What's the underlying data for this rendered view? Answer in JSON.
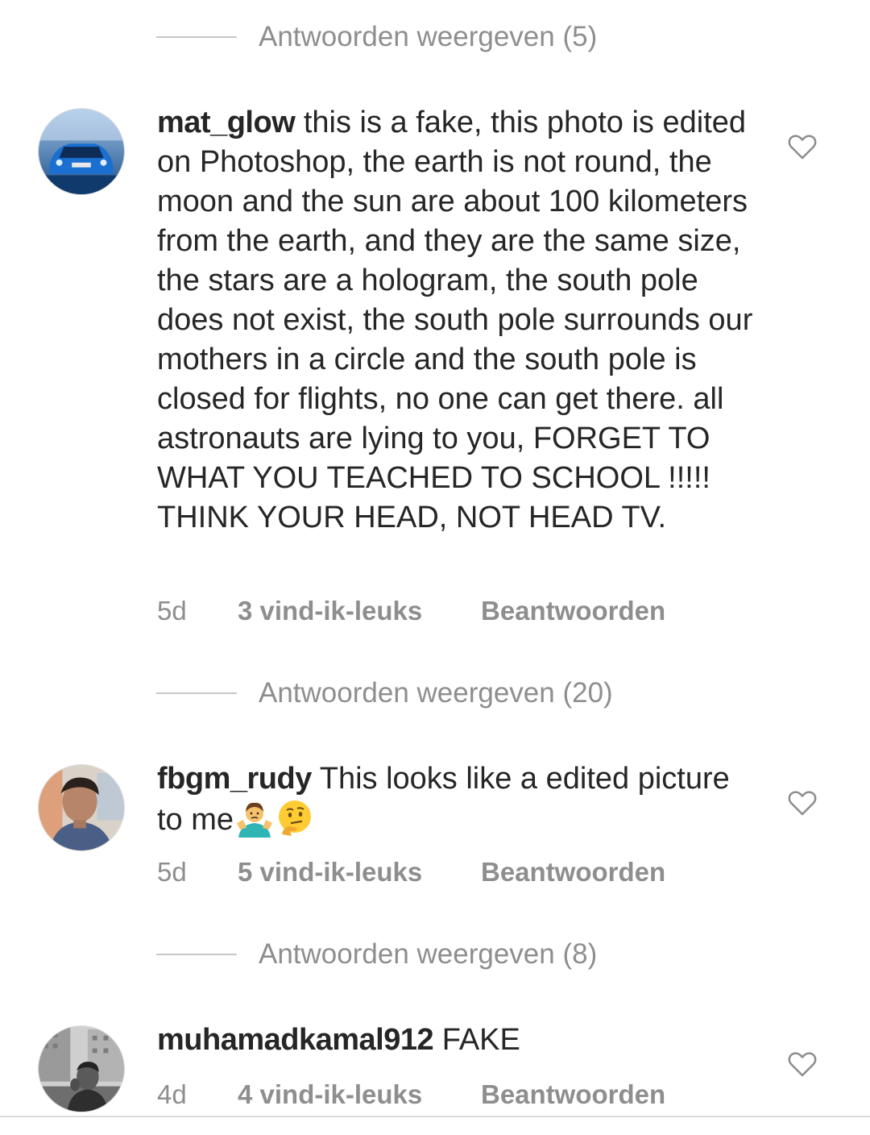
{
  "threads": [
    {
      "replies_label": "Antwoorden weergeven (5)"
    },
    {
      "username": "mat_glow",
      "text": "this is a fake, this photo is edited on Photoshop, the earth is not round, the moon and the sun are about 100 kilometers from the earth, and they are the same size, the stars are a hologram, the south pole does not exist, the south pole surrounds our mothers in a circle and the south pole is closed for flights, no one can get there. all astronauts are lying to you, FORGET TO WHAT YOU TEACHED TO SCHOOL !!!!! THINK YOUR HEAD, NOT HEAD TV.",
      "time": "5d",
      "likes": "3 vind-ik-leuks",
      "reply": "Beantwoorden",
      "replies_label": "Antwoorden weergeven (20)"
    },
    {
      "username": "fbgm_rudy",
      "text": "This looks like a edited picture to me",
      "emojis": [
        "man-shrugging-emoji",
        "thinking-face-emoji"
      ],
      "time": "5d",
      "likes": "5 vind-ik-leuks",
      "reply": "Beantwoorden",
      "replies_label": "Antwoorden weergeven (8)"
    },
    {
      "username": "muhamadkamal912",
      "text": "FAKE",
      "time": "4d",
      "likes": "4 vind-ik-leuks",
      "reply": "Beantwoorden"
    }
  ],
  "colors": {
    "text": "#262626",
    "secondary": "#8e8e8e",
    "divider": "#c7c7c7",
    "heart_outline": "#8e8e8e"
  },
  "icons": {
    "like": "heart-outline-icon"
  }
}
